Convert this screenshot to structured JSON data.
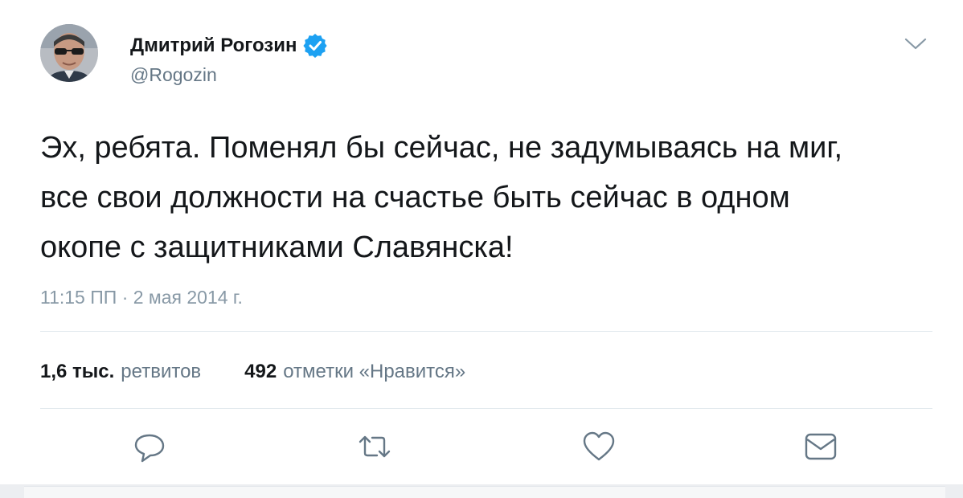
{
  "author": {
    "display_name": "Дмитрий Рогозин",
    "handle": "@Rogozin",
    "verified": true
  },
  "tweet": {
    "lines": [
      "Эх, ребята.  Поменял бы сейчас, не задумываясь на миг,",
      "все свои должности на счастье быть сейчас в одном",
      "окопе с защитниками Славянска!"
    ],
    "timestamp": "11:15 ПП · 2 мая 2014 г."
  },
  "stats": {
    "retweets_count": "1,6 тыс.",
    "retweets_label": "ретвитов",
    "likes_count": "492",
    "likes_label": "отметки «Нравится»"
  },
  "actions": [
    "reply-icon",
    "retweet-icon",
    "like-icon",
    "message-icon"
  ],
  "colors": {
    "text": "#14171a",
    "secondary": "#657786",
    "verified": "#1da1f2",
    "icon": "#657786"
  }
}
